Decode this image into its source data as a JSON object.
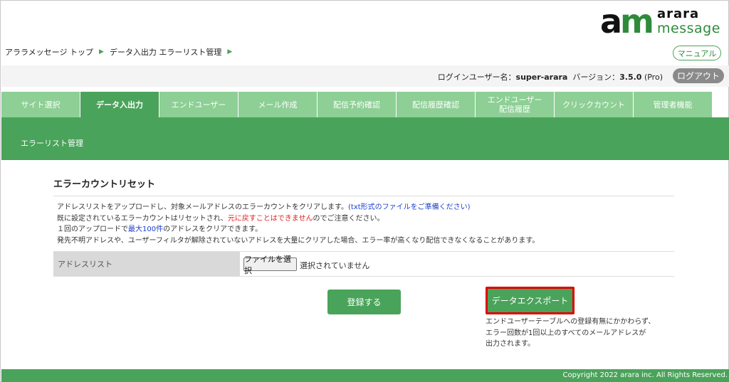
{
  "logo": {
    "mark_a": "a",
    "mark_m": "m",
    "word1": "arara",
    "word2": "message"
  },
  "breadcrumb": [
    "アララメッセージ トップ",
    "データ入出力 エラーリスト管理"
  ],
  "header": {
    "manual_label": "マニュアル",
    "user_label": "ログインユーザー名：",
    "user_name": "super-arara",
    "version_label": "バージョン：",
    "version": "3.5.0",
    "edition": "(Pro)",
    "logout_label": "ログアウト"
  },
  "tabs": [
    {
      "label": "サイト選択",
      "active": false
    },
    {
      "label": "データ入出力",
      "active": true
    },
    {
      "label": "エンドユーザー",
      "active": false
    },
    {
      "label": "メール作成",
      "active": false
    },
    {
      "label": "配信予約確認",
      "active": false
    },
    {
      "label": "配信履歴確認",
      "active": false
    },
    {
      "label": "エンドユーザー\n配信履歴",
      "active": false
    },
    {
      "label": "クリックカウント",
      "active": false
    },
    {
      "label": "管理者機能",
      "active": false
    }
  ],
  "section": {
    "title": "エラーリスト管理"
  },
  "content": {
    "title": "エラーカウントリセット",
    "desc1_a": "アドレスリストをアップロードし、対象メールアドレスのエラーカウントをクリアします。",
    "desc1_b": "(txt形式のファイルをご準備ください)",
    "desc2_a": "既に設定されているエラーカウントはリセットされ、",
    "desc2_b": "元に戻すことはできません",
    "desc2_c": "のでご注意ください。",
    "desc3_a": "１回のアップロードで",
    "desc3_b": "最大100件",
    "desc3_c": "のアドレスをクリアできます。",
    "desc4": "発先不明アドレスや、ユーザーフィルタが解除されていないアドレスを大量にクリアした場合、エラー率が高くなり配信できなくなることがあります。",
    "address_label": "アドレスリスト",
    "file_button": "ファイルを選択",
    "file_status": "選択されていません",
    "register_button": "登録する",
    "export_button": "データエクスポート",
    "export_note1": "エンドユーザーテーブルへの登録有無にかかわらず、",
    "export_note2": "エラー回数が1回以上のすべてのメールアドレスが",
    "export_note3": "出力されます。"
  },
  "footer": {
    "copyright": "Copyright 2022 arara inc. All Rights Reserved."
  },
  "colors": {
    "brand_green": "#4aa35a",
    "tab_light": "#8dcf95",
    "highlight_red": "#e00000"
  }
}
